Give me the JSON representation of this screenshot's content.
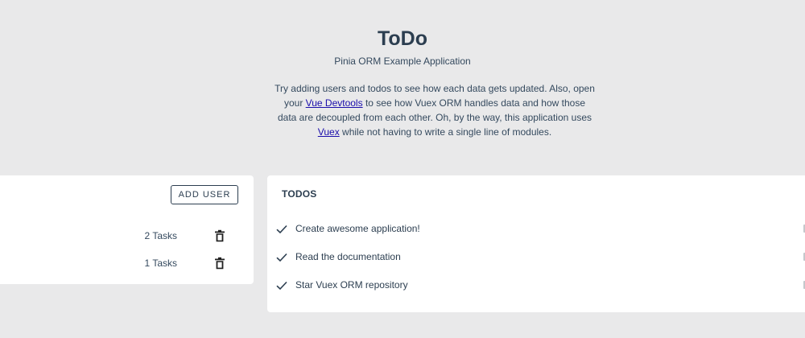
{
  "header": {
    "title": "ToDo",
    "subtitle": "Pinia ORM Example Application",
    "description": {
      "part1": "Try adding users and todos to see how each data gets updated. Also, open your ",
      "link1": "Vue Devtools",
      "part2": " to see how Vuex ORM handles data and how those data are decoupled from each other. Oh, by the way, this application uses ",
      "link2": "Vuex",
      "part3": " while not having to write a single line of modules."
    }
  },
  "users": {
    "add_button_label": "ADD USER",
    "rows": [
      {
        "tasks_label": "2 Tasks",
        "delete_icon": "trash-icon"
      },
      {
        "tasks_label": "1 Tasks",
        "delete_icon": "trash-icon"
      }
    ]
  },
  "todos": {
    "heading": "TODOS",
    "items": [
      {
        "title": "Create awesome application!",
        "done_icon": "check-icon"
      },
      {
        "title": "Read the documentation",
        "done_icon": "check-icon"
      },
      {
        "title": "Star Vuex ORM repository",
        "done_icon": "check-icon"
      }
    ]
  },
  "colors": {
    "background": "#e9e9ea",
    "card": "#ffffff",
    "text": "#2c3e50",
    "link": "#1a0dab"
  }
}
